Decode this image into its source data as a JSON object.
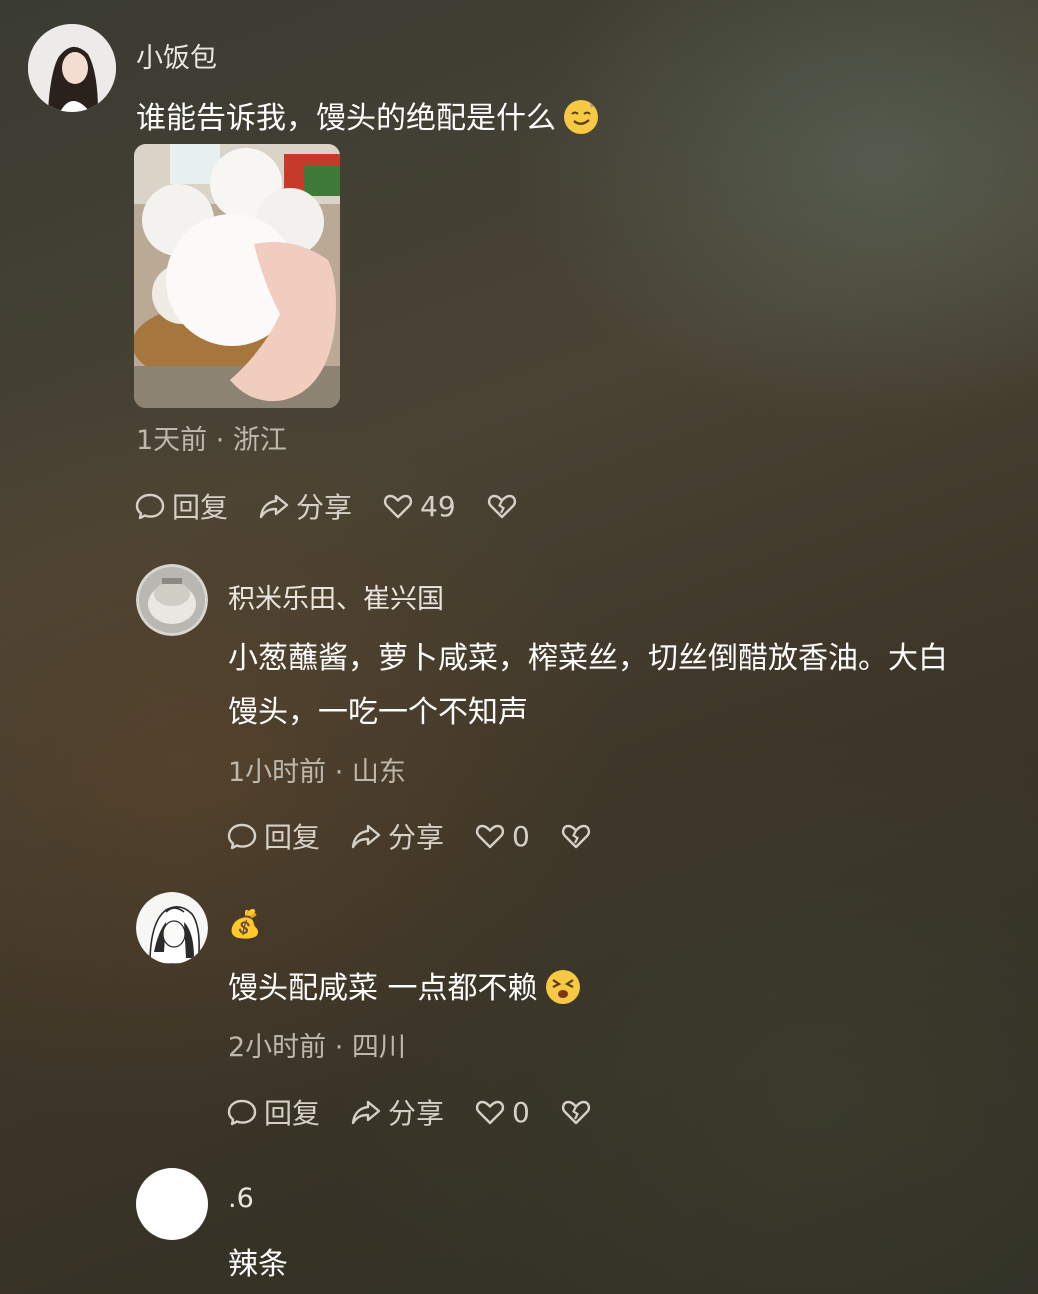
{
  "main_comment": {
    "username": "小饭包",
    "text": "谁能告诉我，馒头的绝配是什么",
    "text_emoji": "smirk-emoji",
    "meta": "1天前 · 浙江",
    "actions": {
      "reply": "回复",
      "share": "分享",
      "like_count": "49"
    }
  },
  "replies": [
    {
      "username": "积米乐田、崔兴国",
      "text_line1": "小葱蘸酱，萝卜咸菜，榨菜丝，切丝倒醋放香油。大白",
      "text_line2": "馒头，一吃一个不知声",
      "meta": "1小时前 · 山东",
      "reply": "回复",
      "share": "分享",
      "like_count": "0"
    },
    {
      "username": "💰",
      "text": "馒头配咸菜 一点都不赖",
      "text_emoji": "squinting-emoji",
      "meta": "2小时前 · 四川",
      "reply": "回复",
      "share": "分享",
      "like_count": "0"
    },
    {
      "username": ".6",
      "text": "辣条"
    }
  ],
  "colors": {
    "text_primary": "#ffffff",
    "text_secondary": "#bdb8ae",
    "emoji_yellow": "#f6c843"
  }
}
